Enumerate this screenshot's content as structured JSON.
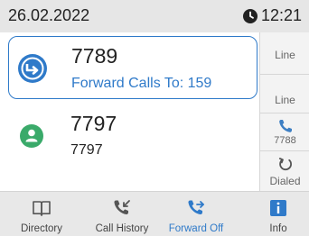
{
  "status_bar": {
    "date": "26.02.2022",
    "time": "12:21",
    "clock_icon": "clock-icon"
  },
  "calls": [
    {
      "number": "7789",
      "subtext": "Forward Calls To: 159",
      "icon": "call-forward-icon",
      "selected": true,
      "accent_color": "#2f7ac9"
    },
    {
      "number": "7797",
      "subtext": "7797",
      "icon": "contact-person-icon",
      "selected": false,
      "accent_color": "#3aaa6a"
    }
  ],
  "line_keys": [
    {
      "label": "Line"
    },
    {
      "label": "Line"
    },
    {
      "label": "7788",
      "icon": "phone-handset-icon"
    },
    {
      "label": "Dialed",
      "icon": "redial-icon"
    }
  ],
  "softkeys": [
    {
      "label": "Directory",
      "icon": "book-icon"
    },
    {
      "label": "Call History",
      "icon": "call-history-icon"
    },
    {
      "label": "Forward Off",
      "icon": "call-forward-icon",
      "active": true
    },
    {
      "label": "Info",
      "icon": "info-icon"
    }
  ],
  "colors": {
    "accent_blue": "#2f7ac9",
    "contact_green": "#3aaa6a",
    "status_bar_bg": "#e6e6e6",
    "softkey_bg": "#e8e8e8"
  }
}
